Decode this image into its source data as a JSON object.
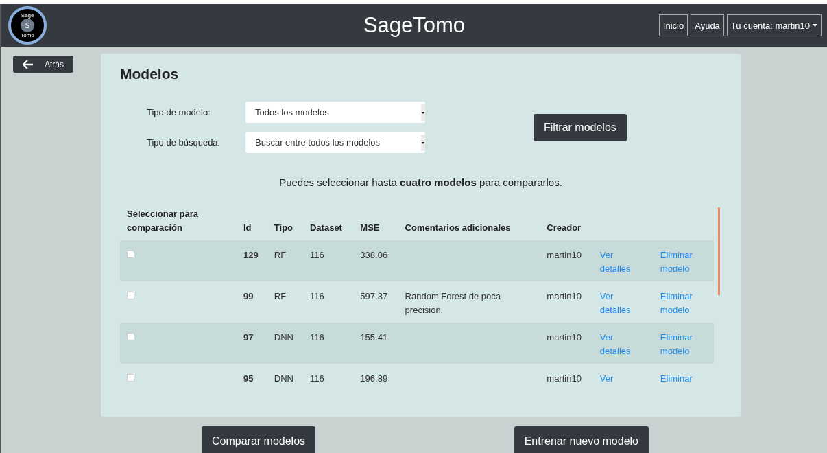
{
  "header": {
    "logo": {
      "top": "Sage",
      "letter": "S",
      "bottom": "Tomo"
    },
    "title": "SageTomo",
    "nav": [
      {
        "label": "Inicio",
        "kind": "link"
      },
      {
        "label": "Ayuda",
        "kind": "link"
      },
      {
        "label": "Tu cuenta: martin10",
        "kind": "dropdown"
      }
    ]
  },
  "back_button": "Atrás",
  "card": {
    "title": "Modelos",
    "filters": [
      {
        "label": "Tipo de modelo:",
        "value": "Todos los modelos"
      },
      {
        "label": "Tipo de búsqueda:",
        "value": "Buscar entre todos los modelos"
      }
    ],
    "filter_button": "Filtrar modelos",
    "note": "Puedes seleccionar hasta **cuatro modelos** para compararlos.",
    "table": {
      "columns": [
        "Seleccionar para comparación",
        "Id",
        "Tipo",
        "Dataset",
        "MSE",
        "Comentarios adicionales",
        "Creador"
      ],
      "rows": [
        {
          "checked": false,
          "id": "129",
          "type": "RF",
          "dataset": "116",
          "mse": "338.06",
          "comment": "",
          "creator": "martin10",
          "details": "Ver detalles",
          "delete": "Eliminar modelo"
        },
        {
          "checked": false,
          "id": "99",
          "type": "RF",
          "dataset": "116",
          "mse": "597.37",
          "comment": "Random Forest de poca precisión.",
          "creator": "martin10",
          "details": "Ver detalles",
          "delete": "Eliminar modelo"
        },
        {
          "checked": false,
          "id": "97",
          "type": "DNN",
          "dataset": "116",
          "mse": "155.41",
          "comment": "",
          "creator": "martin10",
          "details": "Ver detalles",
          "delete": "Eliminar modelo"
        },
        {
          "checked": false,
          "id": "95",
          "type": "DNN",
          "dataset": "116",
          "mse": "196.89",
          "comment": "",
          "creator": "martin10",
          "details": "Ver",
          "delete": "Eliminar"
        }
      ]
    }
  },
  "bottom_buttons": [
    "Comparar modelos",
    "Entrenar nuevo modelo"
  ]
}
